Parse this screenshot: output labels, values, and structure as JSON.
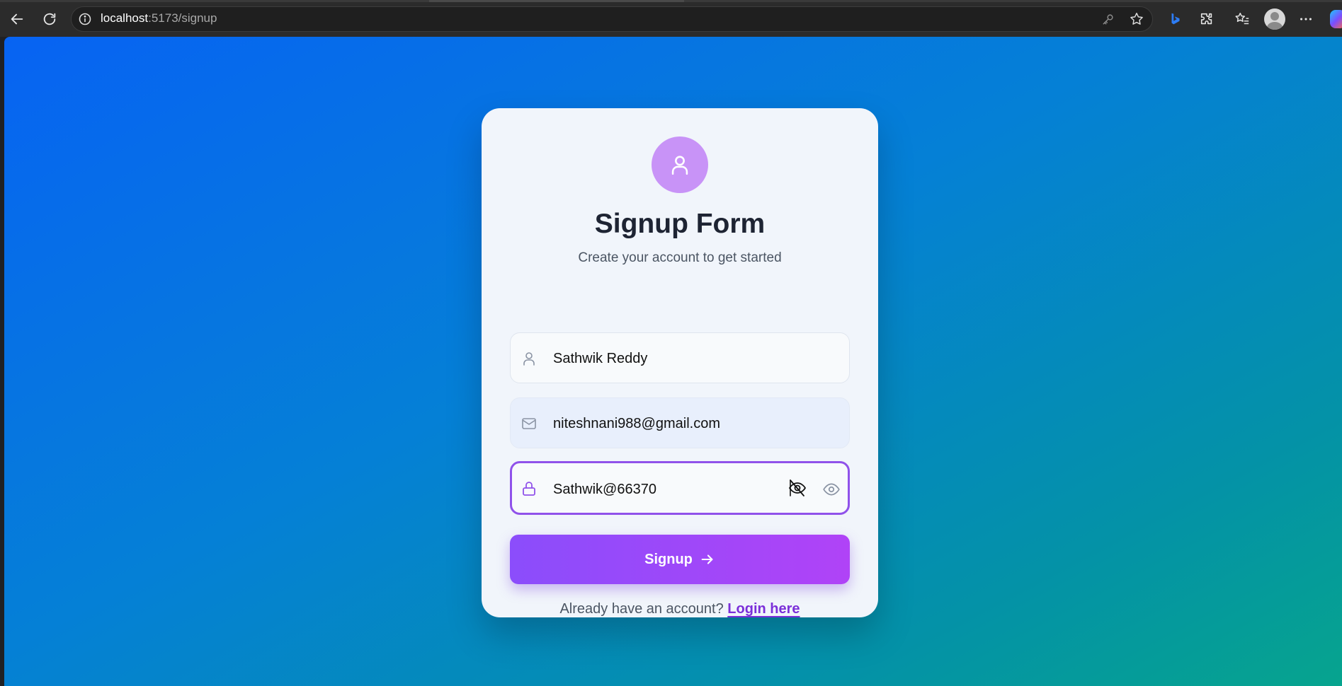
{
  "browser": {
    "url_host": "localhost",
    "url_rest": ":5173/signup"
  },
  "form": {
    "title": "Signup Form",
    "subtitle": "Create your account to get started",
    "name_value": "Sathwik Reddy",
    "email_value": "niteshnani988@gmail.com",
    "password_value": "Sathwik@66370",
    "submit_label": "Signup",
    "login_prompt": "Already have an account?",
    "login_link": "Login here"
  },
  "colors": {
    "accent": "#9052ea",
    "button_start": "#8b4dfb",
    "button_end": "#b043f7",
    "avatar_bg": "#c893f7",
    "link": "#7b2fd9"
  },
  "icons": [
    "back-icon",
    "reload-icon",
    "info-icon",
    "key-icon",
    "star-icon",
    "bing-icon",
    "extensions-icon",
    "favorites-icon",
    "profile-avatar",
    "more-icon",
    "copilot-icon",
    "user-icon",
    "mail-icon",
    "lock-icon",
    "eye-off-icon",
    "eye-icon",
    "arrow-right-icon"
  ]
}
